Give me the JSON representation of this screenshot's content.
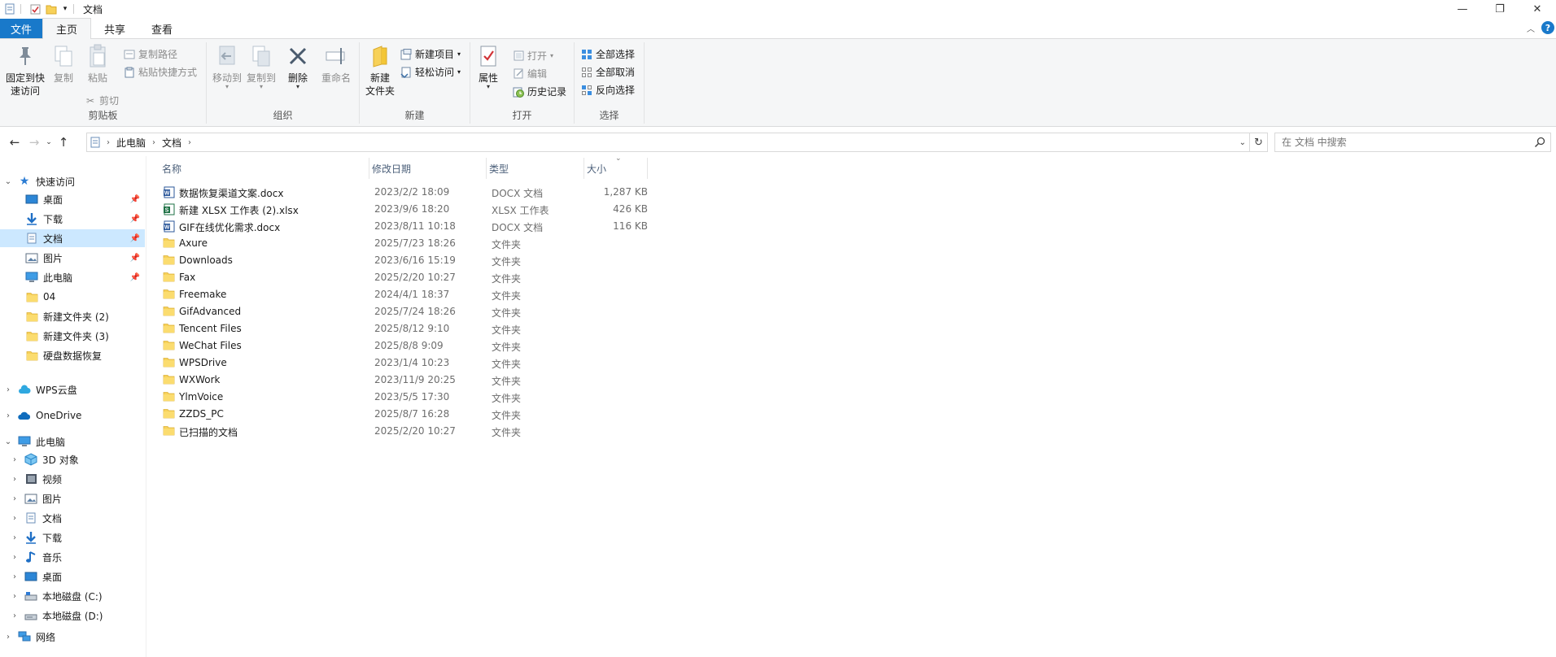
{
  "window": {
    "title": "文档"
  },
  "ribbon_tabs": [
    "文件",
    "主页",
    "共享",
    "查看"
  ],
  "ribbon": {
    "clipboard": {
      "label": "剪贴板",
      "pin": "固定到快\n速访问",
      "copy": "复制",
      "paste": "粘贴",
      "copy_path": "复制路径",
      "paste_shortcut": "粘贴快捷方式",
      "cut": "剪切"
    },
    "organize": {
      "label": "组织",
      "move_to": "移动到",
      "copy_to": "复制到",
      "delete": "删除",
      "rename": "重命名"
    },
    "new": {
      "label": "新建",
      "new_folder": "新建\n文件夹",
      "new_item": "新建项目",
      "easy_access": "轻松访问"
    },
    "open": {
      "label": "打开",
      "properties": "属性",
      "open": "打开",
      "edit": "编辑",
      "history": "历史记录"
    },
    "select": {
      "label": "选择",
      "select_all": "全部选择",
      "select_none": "全部取消",
      "invert": "反向选择"
    }
  },
  "address": {
    "crumbs": [
      "此电脑",
      "文档"
    ],
    "search_placeholder": "在 文档 中搜索"
  },
  "nav": {
    "quick_access": "快速访问",
    "quick_items": [
      "桌面",
      "下载",
      "文档",
      "图片",
      "此电脑",
      "04",
      "新建文件夹 (2)",
      "新建文件夹 (3)",
      "硬盘数据恢复"
    ],
    "wps": "WPS云盘",
    "onedrive": "OneDrive",
    "this_pc": "此电脑",
    "pc_items": [
      "3D 对象",
      "视频",
      "图片",
      "文档",
      "下载",
      "音乐",
      "桌面",
      "本地磁盘 (C:)",
      "本地磁盘 (D:)"
    ],
    "network": "网络"
  },
  "columns": {
    "name": "名称",
    "date": "修改日期",
    "type": "类型",
    "size": "大小"
  },
  "files": [
    {
      "name": "数据恢复渠道文案.docx",
      "date": "2023/2/2 18:09",
      "type": "DOCX 文档",
      "size": "1,287 KB",
      "icon": "word-icon"
    },
    {
      "name": "新建 XLSX 工作表 (2).xlsx",
      "date": "2023/9/6 18:20",
      "type": "XLSX 工作表",
      "size": "426 KB",
      "icon": "excel-icon"
    },
    {
      "name": "GIF在线优化需求.docx",
      "date": "2023/8/11 10:18",
      "type": "DOCX 文档",
      "size": "116 KB",
      "icon": "word-icon"
    },
    {
      "name": "Axure",
      "date": "2025/7/23 18:26",
      "type": "文件夹",
      "size": "",
      "icon": "folder-icon"
    },
    {
      "name": "Downloads",
      "date": "2023/6/16 15:19",
      "type": "文件夹",
      "size": "",
      "icon": "folder-icon"
    },
    {
      "name": "Fax",
      "date": "2025/2/20 10:27",
      "type": "文件夹",
      "size": "",
      "icon": "folder-icon"
    },
    {
      "name": "Freemake",
      "date": "2024/4/1 18:37",
      "type": "文件夹",
      "size": "",
      "icon": "folder-icon"
    },
    {
      "name": "GifAdvanced",
      "date": "2025/7/24 18:26",
      "type": "文件夹",
      "size": "",
      "icon": "folder-icon"
    },
    {
      "name": "Tencent Files",
      "date": "2025/8/12 9:10",
      "type": "文件夹",
      "size": "",
      "icon": "folder-icon"
    },
    {
      "name": "WeChat Files",
      "date": "2025/8/8 9:09",
      "type": "文件夹",
      "size": "",
      "icon": "folder-icon"
    },
    {
      "name": "WPSDrive",
      "date": "2023/1/4 10:23",
      "type": "文件夹",
      "size": "",
      "icon": "folder-icon"
    },
    {
      "name": "WXWork",
      "date": "2023/11/9 20:25",
      "type": "文件夹",
      "size": "",
      "icon": "folder-icon"
    },
    {
      "name": "YlmVoice",
      "date": "2023/5/5 17:30",
      "type": "文件夹",
      "size": "",
      "icon": "folder-icon"
    },
    {
      "name": "ZZDS_PC",
      "date": "2025/8/7 16:28",
      "type": "文件夹",
      "size": "",
      "icon": "folder-icon"
    },
    {
      "name": "已扫描的文档",
      "date": "2025/2/20 10:27",
      "type": "文件夹",
      "size": "",
      "icon": "folder-icon"
    }
  ],
  "colors": {
    "accent": "#1979ca",
    "selection": "#cce8ff",
    "folder": "#f7d159"
  }
}
